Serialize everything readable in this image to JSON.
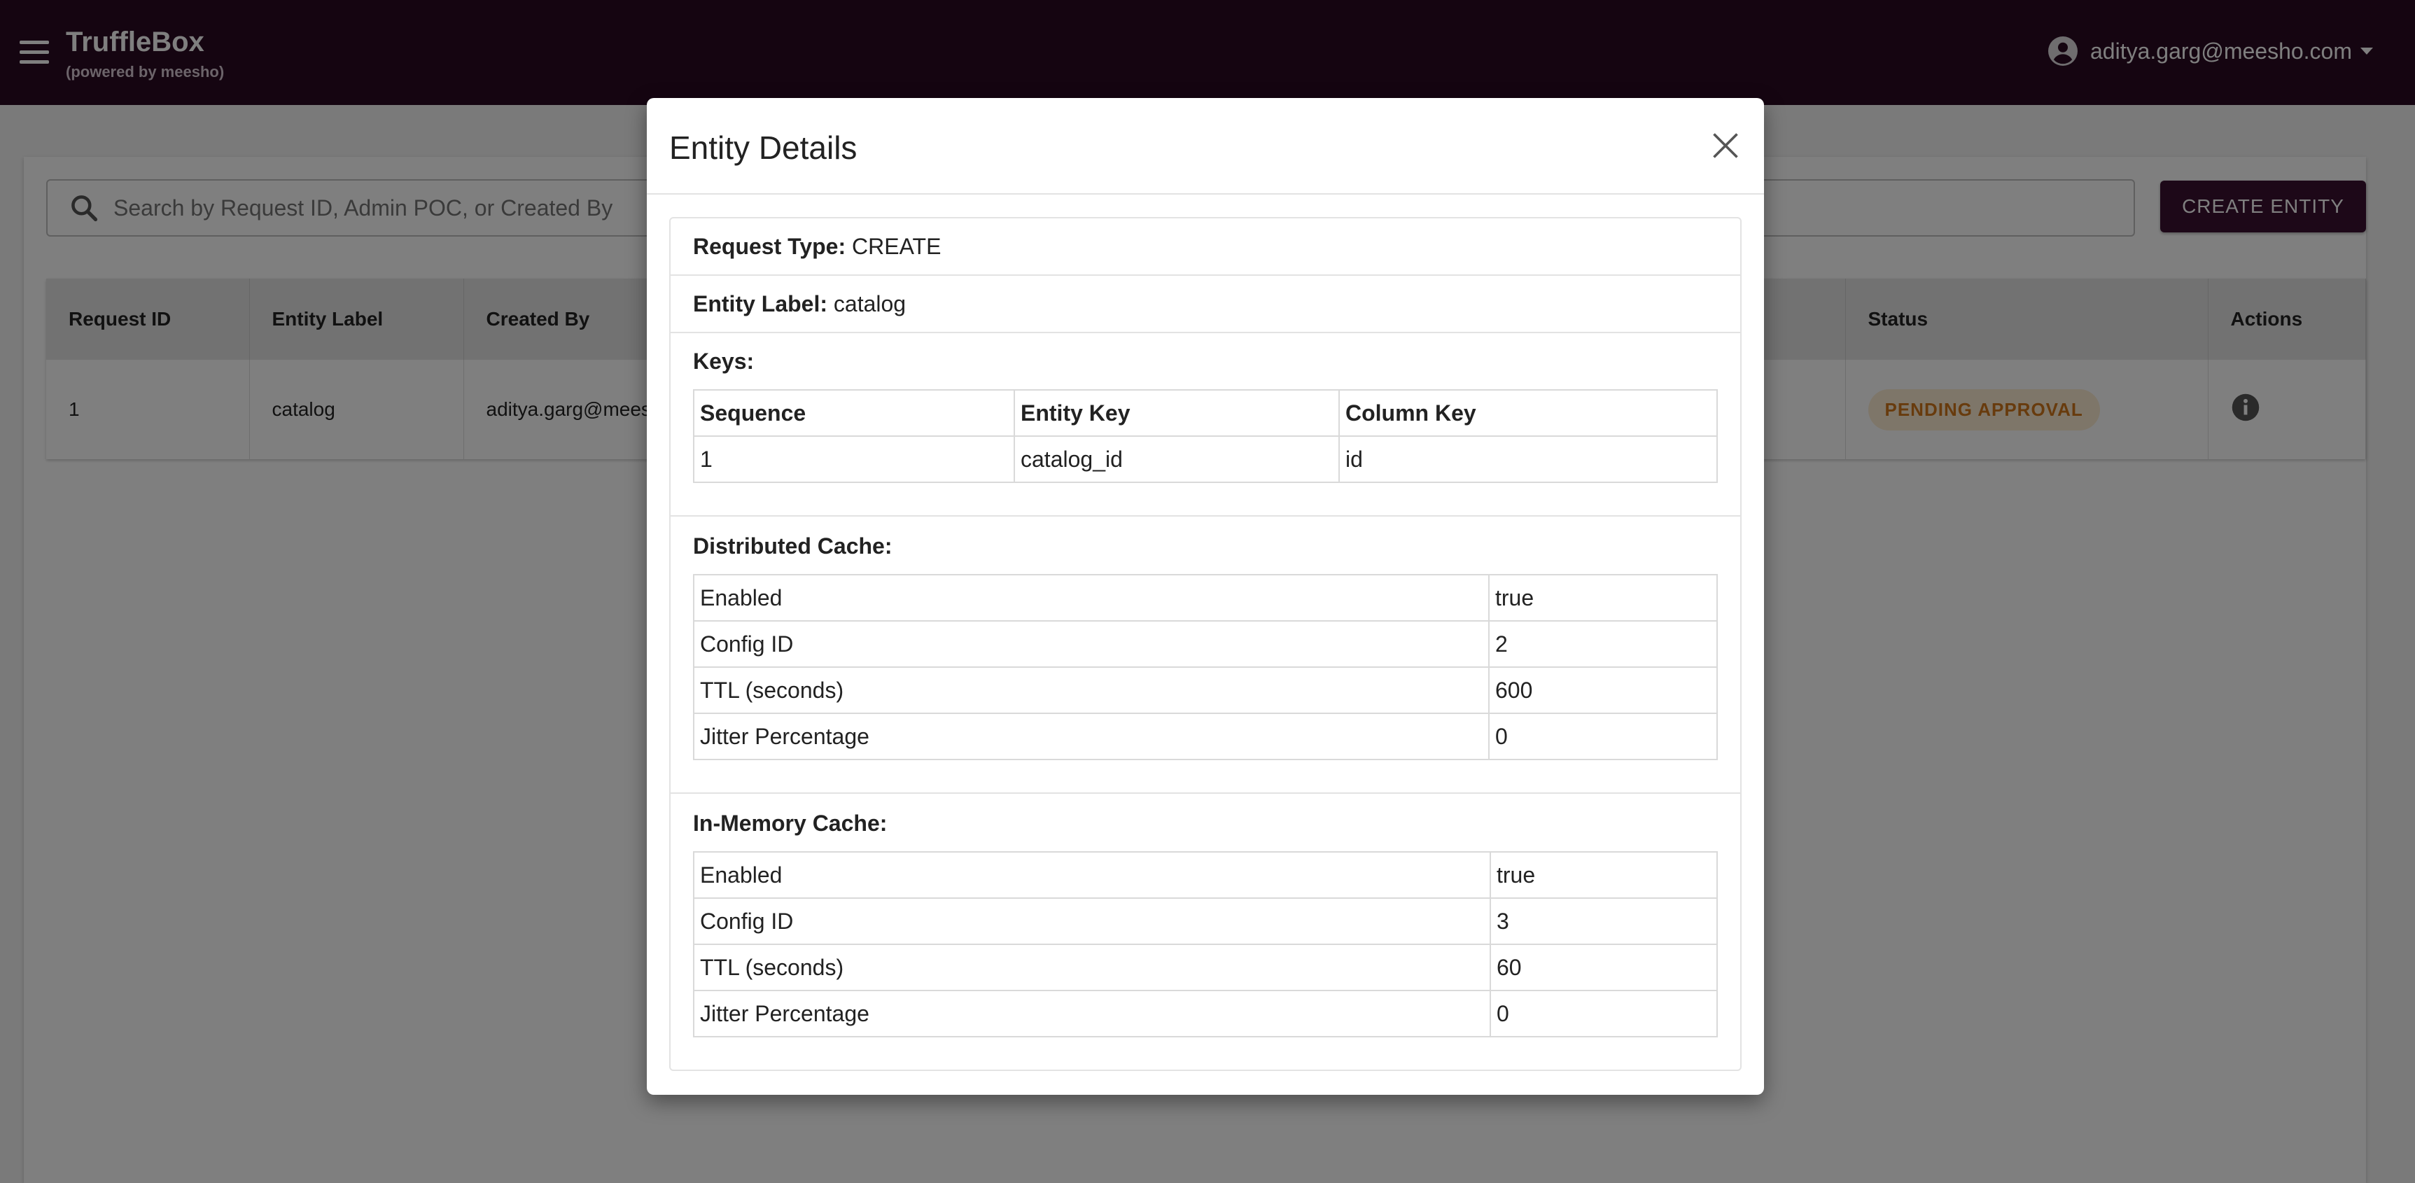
{
  "header": {
    "app_title": "TruffleBox",
    "app_subtitle": "(powered by meesho)",
    "user_email": "aditya.garg@meesho.com"
  },
  "search": {
    "placeholder": "Search by Request ID, Admin POC, or Created By"
  },
  "create_button_label": "CREATE ENTITY",
  "table": {
    "columns": [
      "Request ID",
      "Entity Label",
      "Created By",
      "Status",
      "Actions"
    ],
    "rows": [
      {
        "request_id": "1",
        "entity_label": "catalog",
        "created_by": "aditya.garg@mees",
        "status": "PENDING APPROVAL"
      }
    ]
  },
  "modal": {
    "title": "Entity Details",
    "request_type_label": "Request Type:",
    "request_type_value": "CREATE",
    "entity_label_label": "Entity Label:",
    "entity_label_value": "catalog",
    "keys_title": "Keys:",
    "keys_columns": [
      "Sequence",
      "Entity Key",
      "Column Key"
    ],
    "keys_rows": [
      {
        "sequence": "1",
        "entity_key": "catalog_id",
        "column_key": "id"
      }
    ],
    "distributed_cache": {
      "title": "Distributed Cache:",
      "rows": [
        {
          "label": "Enabled",
          "value": "true"
        },
        {
          "label": "Config ID",
          "value": "2"
        },
        {
          "label": "TTL (seconds)",
          "value": "600"
        },
        {
          "label": "Jitter Percentage",
          "value": "0"
        }
      ]
    },
    "in_memory_cache": {
      "title": "In-Memory Cache:",
      "rows": [
        {
          "label": "Enabled",
          "value": "true"
        },
        {
          "label": "Config ID",
          "value": "3"
        },
        {
          "label": "TTL (seconds)",
          "value": "60"
        },
        {
          "label": "Jitter Percentage",
          "value": "0"
        }
      ]
    }
  },
  "colors": {
    "header_bg": "#2a0a22",
    "primary_button": "#3a1030",
    "status_badge_bg": "#fcecd3",
    "status_badge_text": "#d0761a"
  },
  "icons": [
    "menu-icon",
    "account-icon",
    "chevron-down-icon",
    "search-icon",
    "info-icon",
    "close-icon"
  ]
}
